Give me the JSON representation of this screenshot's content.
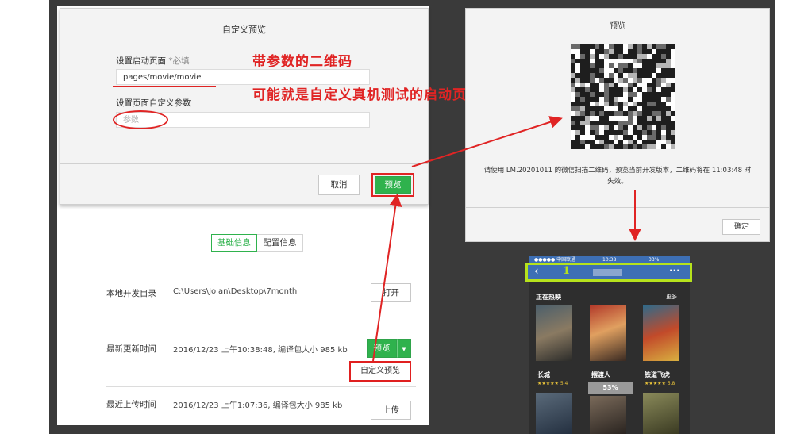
{
  "dialog": {
    "title": "自定义预览",
    "start_page_label": "设置启动页面",
    "required_mark": "*必填",
    "start_page_value": "pages/movie/movie",
    "params_label": "设置页面自定义参数",
    "params_placeholder": "参数",
    "cancel_label": "取消",
    "preview_label": "预览"
  },
  "annotations": {
    "line1": "带参数的二维码",
    "line2": "可能就是自定义真机测试的启动页"
  },
  "project": {
    "tabs": [
      "基础信息",
      "配置信息"
    ],
    "rows": [
      {
        "label": "本地开发目录",
        "value": "C:\\Users\\Joian\\Desktop\\7month",
        "action": "打开"
      },
      {
        "label": "最新更新时间",
        "value": "2016/12/23 上午10:38:48, 编译包大小 985 kb",
        "action": "预览"
      },
      {
        "label": "最近上传时间",
        "value": "2016/12/23 上午1:07:36, 编译包大小 985 kb",
        "action": "上传"
      }
    ],
    "dropdown_item": "自定义预览"
  },
  "preview": {
    "title": "预览",
    "message_line1": "请使用 LM.20201011 的微信扫描二维码，预览当前开发版本，二维码将在 11:03:48 时",
    "message_line2": "失效。",
    "confirm_label": "确定"
  },
  "phone": {
    "carrier": "●●●●● 中国联通",
    "time": "10:38",
    "battery": "33%",
    "nav_number": "1",
    "more": "···",
    "section_title": "正在热映",
    "see_all": "更多",
    "progress_text": "53%",
    "movies": [
      "长城",
      "摆渡人",
      "铁道飞虎"
    ],
    "scores": [
      "5.4",
      "",
      "5.8"
    ]
  },
  "colors": {
    "red_annotation": "#e02424",
    "green_button": "#2fb24d",
    "highlight_green": "#b6e21c"
  }
}
